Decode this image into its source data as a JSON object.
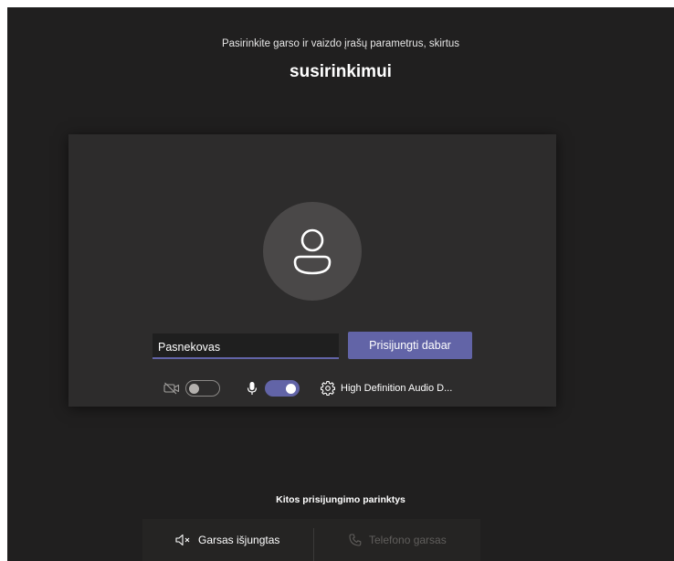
{
  "header": {
    "subtitle": "Pasirinkite garso ir vaizdo įrašų parametrus, skirtus",
    "title": "susirinkimui"
  },
  "prejoin": {
    "name_input": {
      "value": "Pasnekovas",
      "placeholder": ""
    },
    "join_button_label": "Prisijungti dabar",
    "camera": {
      "enabled": false,
      "icon": "camera-off-icon"
    },
    "microphone": {
      "enabled": true,
      "icon": "microphone-icon"
    },
    "audio_device": {
      "icon": "gear-icon",
      "label": "High Definition Audio D..."
    }
  },
  "other_options": {
    "title": "Kitos prisijungimo parinktys",
    "items": [
      {
        "label": "Garsas išjungtas",
        "icon": "speaker-off-icon",
        "enabled": true
      },
      {
        "label": "Telefono garsas",
        "icon": "phone-icon",
        "enabled": false
      }
    ]
  },
  "colors": {
    "background": "#201f1f",
    "card": "#2d2c2c",
    "accent": "#6264a7",
    "avatar": "#4a4848",
    "disabled_text": "#605e5c"
  }
}
